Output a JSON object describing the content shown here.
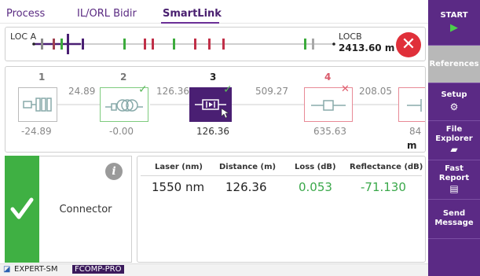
{
  "tabs": [
    {
      "label": "Process"
    },
    {
      "label": "IL/ORL Bidir"
    },
    {
      "label": "SmartLink"
    }
  ],
  "link": {
    "loc_a": "LOC A",
    "loc_b": "LOCB",
    "distance": "2413.60 m",
    "status": "fail",
    "status_color": "#e0303a"
  },
  "events": [
    {
      "number": "1",
      "icon": "connector-pair-icon",
      "segment": "24.89",
      "position": "-24.89",
      "status": "none"
    },
    {
      "number": "2",
      "icon": "splice-coil-icon",
      "segment": "126.36",
      "position": "-0.00",
      "status": "pass"
    },
    {
      "number": "3",
      "icon": "connector-icon",
      "segment": "509.27",
      "position": "126.36",
      "status": "pass",
      "selected": true
    },
    {
      "number": "4",
      "icon": "reflective-icon",
      "segment": "208.05",
      "position": "635.63",
      "status": "fail"
    },
    {
      "number": "",
      "icon": "end-icon",
      "segment": "",
      "position": "84",
      "status": "none"
    }
  ],
  "unit": "m",
  "selected_event": {
    "type": "Connector",
    "status": "pass",
    "headers": {
      "laser": "Laser (nm)",
      "distance": "Distance (m)",
      "loss": "Loss  (dB)",
      "reflectance": "Reflectance (dB)"
    },
    "values": {
      "laser": "1550 nm",
      "distance": "126.36",
      "loss": "0.053",
      "reflectance": "-71.130"
    }
  },
  "sidebar": {
    "start": "START",
    "references": "References",
    "setup": "Setup",
    "file_explorer_1": "File",
    "file_explorer_2": "Explorer",
    "fast_report_1": "Fast",
    "fast_report_2": "Report",
    "send_message_1": "Send",
    "send_message_2": "Message"
  },
  "statusbar": {
    "expert": "EXPERT-SM",
    "fcomp": "FCOMP-PRO"
  },
  "colors": {
    "accent": "#5b2a85",
    "pass": "#3fb043",
    "fail": "#e0303a"
  }
}
